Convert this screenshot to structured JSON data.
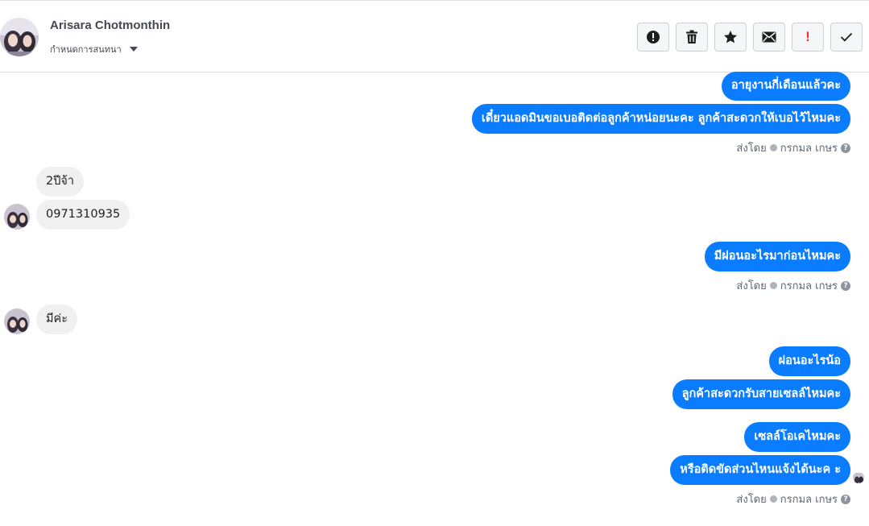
{
  "header": {
    "name": "Arisara Chotmonthin",
    "subtitle": "กำหนดการสนทนา",
    "actions": [
      {
        "icon": "alert-circle-icon"
      },
      {
        "icon": "trash-icon"
      },
      {
        "icon": "star-icon"
      },
      {
        "icon": "mail-icon"
      },
      {
        "icon": "important-icon",
        "label": "!"
      },
      {
        "icon": "check-icon"
      }
    ]
  },
  "messages": {
    "m1": "อายุงานกี่เดือนแล้วคะ",
    "m2": "เดี๋ยวแอดมินขอเบอติดต่อลูกค้าหน่อยนะคะ ลูกค้าสะดวกให้เบอไว้ไหมคะ",
    "m3": "2ปีจ้า",
    "m4": "0971310935",
    "m5": "มีผ่อนอะไรมาก่อนไหมคะ",
    "m6": "มีค่ะ",
    "m7": "ผ่อนอะไรน้อ",
    "m8": "ลูกค้าสะดวกรับสายเซลล์ไหมคะ",
    "m9": "เซลล์โอเคไหมคะ",
    "m10": "หรือติดขัดส่วนไหนแจ้งได้นะค ะ"
  },
  "sent_by": {
    "prefix": "ส่งโดย",
    "name": "กรกมล เกษร",
    "help": "?"
  },
  "colors": {
    "outgoing": "#0a7cff",
    "incoming": "#f1f0f0",
    "important": "#e03a2e"
  }
}
